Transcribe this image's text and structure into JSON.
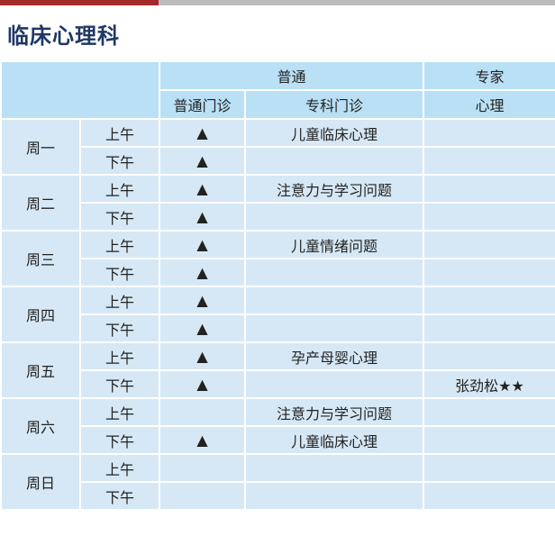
{
  "title": "临床心理科",
  "header": {
    "group_general": "普通",
    "group_expert": "专家",
    "col_general_clinic": "普通门诊",
    "col_specialist_clinic": "专科门诊",
    "col_psychology": "心理"
  },
  "days": [
    {
      "name": "周一",
      "slots": [
        {
          "period": "上午",
          "general": "▲",
          "specialist": "儿童临床心理",
          "expert": ""
        },
        {
          "period": "下午",
          "general": "▲",
          "specialist": "",
          "expert": ""
        }
      ]
    },
    {
      "name": "周二",
      "slots": [
        {
          "period": "上午",
          "general": "▲",
          "specialist": "注意力与学习问题",
          "expert": ""
        },
        {
          "period": "下午",
          "general": "▲",
          "specialist": "",
          "expert": ""
        }
      ]
    },
    {
      "name": "周三",
      "slots": [
        {
          "period": "上午",
          "general": "▲",
          "specialist": "儿童情绪问题",
          "expert": ""
        },
        {
          "period": "下午",
          "general": "▲",
          "specialist": "",
          "expert": ""
        }
      ]
    },
    {
      "name": "周四",
      "slots": [
        {
          "period": "上午",
          "general": "▲",
          "specialist": "",
          "expert": ""
        },
        {
          "period": "下午",
          "general": "▲",
          "specialist": "",
          "expert": ""
        }
      ]
    },
    {
      "name": "周五",
      "slots": [
        {
          "period": "上午",
          "general": "▲",
          "specialist": "孕产母婴心理",
          "expert": ""
        },
        {
          "period": "下午",
          "general": "▲",
          "specialist": "",
          "expert": "张劲松★★"
        }
      ]
    },
    {
      "name": "周六",
      "slots": [
        {
          "period": "上午",
          "general": "",
          "specialist": "注意力与学习问题",
          "expert": ""
        },
        {
          "period": "下午",
          "general": "▲",
          "specialist": "儿童临床心理",
          "expert": ""
        }
      ]
    },
    {
      "name": "周日",
      "slots": [
        {
          "period": "上午",
          "general": "",
          "specialist": "",
          "expert": ""
        },
        {
          "period": "下午",
          "general": "",
          "specialist": "",
          "expert": ""
        }
      ]
    }
  ]
}
